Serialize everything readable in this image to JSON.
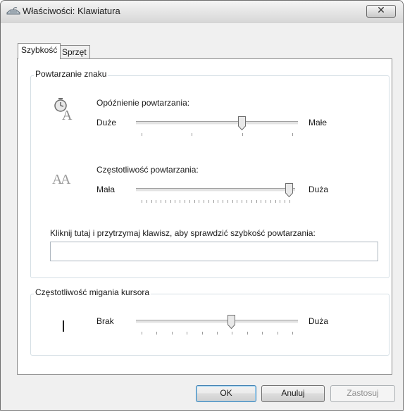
{
  "window": {
    "title": "Właściwości: Klawiatura",
    "close_glyph": "✕"
  },
  "tabs": [
    {
      "label": "Szybkość",
      "active": true
    },
    {
      "label": "Sprzęt",
      "active": false
    }
  ],
  "repeat_group": {
    "legend": "Powtarzanie znaku",
    "delay": {
      "label": "Opóźnienie powtarzania:",
      "min_label": "Duże",
      "max_label": "Małe",
      "value": 2,
      "max": 3,
      "icon": "clock-letter-icon"
    },
    "rate": {
      "label": "Częstotliwość powtarzania:",
      "min_label": "Mała",
      "max_label": "Duża",
      "value": 31,
      "max": 31,
      "icon": "double-letter-icon"
    },
    "test": {
      "label": "Kliknij tutaj i przytrzymaj klawisz, aby sprawdzić szybkość powtarzania:",
      "value": ""
    }
  },
  "blink_group": {
    "legend": "Częstotliwość migania kursora",
    "min_label": "Brak",
    "max_label": "Duża",
    "value": 6,
    "max": 10,
    "icon": "text-cursor-icon"
  },
  "buttons": {
    "ok": "OK",
    "cancel": "Anuluj",
    "apply": "Zastosuj"
  },
  "colors": {
    "accent_border": "#3c7fb1",
    "group_border": "#d5dfe5"
  }
}
